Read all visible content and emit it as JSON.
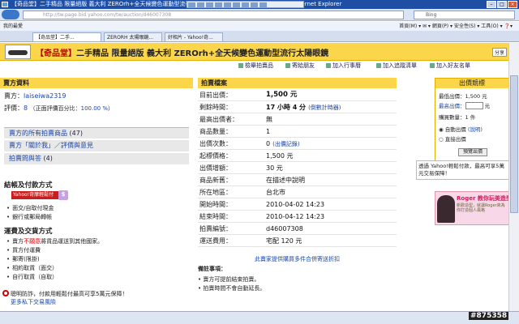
{
  "browser": {
    "window_title": "【奇品堂】二手精品 限量絕版 義大利 ZEROrh+全天候變色運動型流行太陽眼鏡 - Yahoo!奇摩拍賣 - Windows Internet Explorer",
    "url": "http://tw.page.bid.yahoo.com/tw/auction/d46007308",
    "search_placeholder": "Bing",
    "favorites_label": "我的最愛",
    "tabs": [
      "【奇品堂】二手...",
      "ZERORH 太陽眼鏡...",
      "好相片 - Yahoo!奇..."
    ],
    "menu_items": "首頁(M) ▾  ✉ ▾  網頁(P) ▾  安全性(S) ▾  工具(O) ▾  ❓▾"
  },
  "item": {
    "title_shop": "【奇品堂】",
    "title_rest": "二手精品 限量絕版 義大利 ZEROrh+全天候變色運動型流行太陽眼鏡",
    "share": "分享",
    "actions": [
      "檢舉拍賣品",
      "寄給朋友",
      "加入行事曆",
      "加入追蹤清單",
      "加入好友名單"
    ]
  },
  "seller": {
    "heading": "賣方資料",
    "seller_label": "賣方：",
    "seller_name": "laiseiwa2319",
    "rating_label": "評價：",
    "rating_value": "8",
    "rating_pct_text": "（正面評價百分比：",
    "rating_pct": "100.00 %",
    "rating_close": "）",
    "links": [
      {
        "text": "賣方的所有拍賣商品",
        "count": "(47)"
      },
      {
        "text": "賣方「關於我」／評價與意見",
        "count": ""
      },
      {
        "text": "拍賣問與答",
        "count": "(4)"
      }
    ]
  },
  "payment": {
    "heading": "結帳及付款方式",
    "badge": "Yahoo!奇摩輕鬆付",
    "badge_s": "$",
    "items": [
      "面交/自取付現金",
      "銀行或郵局轉帳"
    ]
  },
  "shipping": {
    "heading": "運費及交貨方式",
    "items_prefix": "賣方",
    "items_red": "不願意",
    "items_suffix": "將貨品運送到其他國家。",
    "items": [
      "買方付運費",
      "郵寄(限掛)",
      "相約取貨（面交）",
      "自行取貨（自取）"
    ]
  },
  "warning": {
    "text": "聰明防詐，付款用輕鬆付最高可享5萬元保障！",
    "link": "更多私下交易風險"
  },
  "auction": {
    "heading": "拍賣檔案",
    "rows": [
      {
        "k": "目前出價：",
        "v": "1,500 元",
        "style": "big"
      },
      {
        "k": "剩餘時間：",
        "v": "17 小時 4 分",
        "extra": "(倒數計時器)",
        "style": "b"
      },
      {
        "k": "最高出價者：",
        "v": "無",
        "style": ""
      },
      {
        "k": "商品數量：",
        "v": "1",
        "style": ""
      },
      {
        "k": "出價次數：",
        "v": "0",
        "extra": "(出價記錄)",
        "style": ""
      },
      {
        "k": "起標價格：",
        "v": "1,500 元",
        "style": ""
      },
      {
        "k": "出價增額：",
        "v": "30 元",
        "style": ""
      },
      {
        "k": "商品新舊：",
        "v": "在描述中說明",
        "style": ""
      },
      {
        "k": "所在地區：",
        "v": "台北市",
        "style": ""
      },
      {
        "k": "開始時間：",
        "v": "2010-04-02 14:23",
        "style": ""
      },
      {
        "k": "結束時間：",
        "v": "2010-04-12 14:23",
        "style": ""
      },
      {
        "k": "拍賣編號：",
        "v": "d46007308",
        "style": ""
      },
      {
        "k": "運送費用：",
        "v": "宅配 120 元",
        "style": ""
      }
    ],
    "combine_link": "此賣家提供購買多件合併寄送折扣",
    "notes_heading": "備註事項：",
    "notes": [
      "賣方可提前結束拍賣。",
      "拍賣時間不會自動延長。"
    ]
  },
  "bid_panel": {
    "heading": "出價競標",
    "lowest_label": "最低出價：",
    "lowest_value": "1,500 元",
    "max_label": "最高出價：",
    "max_unit": "元",
    "qty_label": "購買數量：",
    "qty_value": "1 件",
    "auto_label": "自動出價",
    "auto_extra": "(說明)",
    "direct_label": "直接出價",
    "button": "預覽出價",
    "tip": "透過 Yahoo!輕鬆付款，最高可享5萬元交易保障！"
  },
  "ad": {
    "title": "Roger 教你玩美造型",
    "body": "新歡造型，就讓Roger來為你打造個人風格"
  },
  "watermark": "#875358"
}
